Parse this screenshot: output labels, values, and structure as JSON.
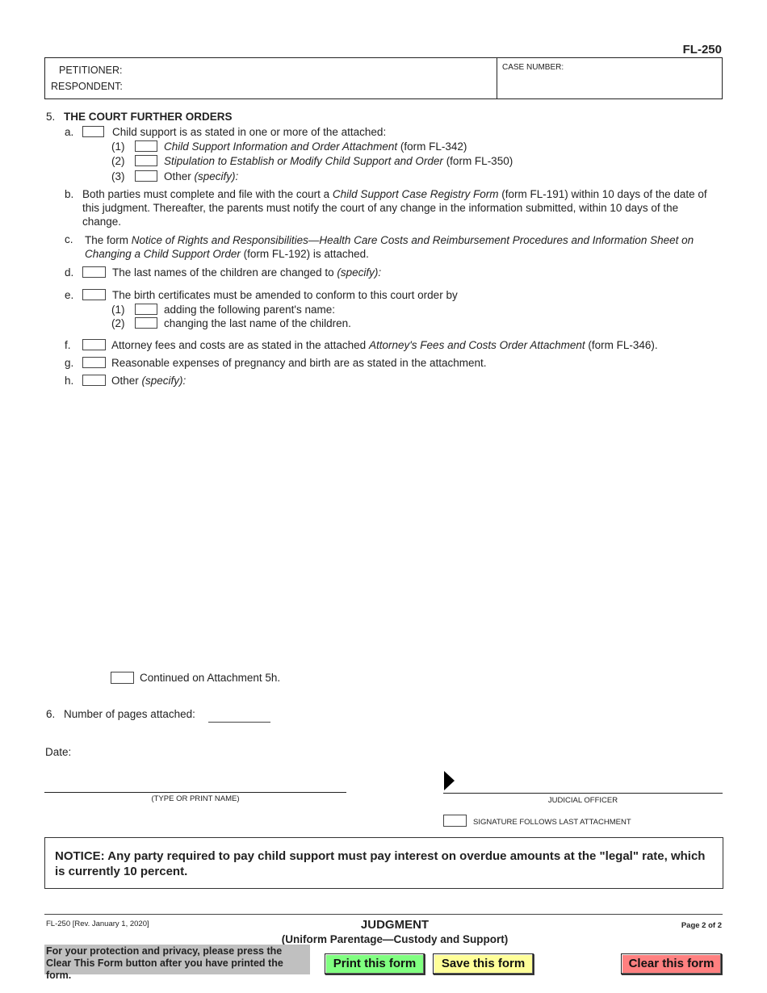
{
  "header": {
    "form_number": "FL-250",
    "petitioner_label": "PETITIONER:",
    "respondent_label": "RESPONDENT:",
    "case_number_label": "CASE NUMBER:"
  },
  "section5": {
    "number": "5.",
    "title": "THE COURT FURTHER ORDERS",
    "a": {
      "label": "a.",
      "text": "Child support is as stated in one or more of the attached:",
      "items": [
        {
          "label": "(1)",
          "italic": "Child Support Information and Order Attachment",
          "text": " (form FL-342)"
        },
        {
          "label": "(2)",
          "italic": "Stipulation to Establish or Modify Child Support and Order",
          "text": " (form FL-350)"
        },
        {
          "label": "(3)",
          "text": "Other ",
          "italic": "(specify):"
        }
      ]
    },
    "b": {
      "label": "b.",
      "text1": "Both parties must complete and file with the court a ",
      "italic": "Child Support Case Registry Form",
      "text2": " (form FL-191) within 10 days of the date of this judgment. Thereafter, the parents must notify the court of any change in the information submitted, within 10 days of the change."
    },
    "c": {
      "label": "c.",
      "text1": "The form ",
      "italic": "Notice of Rights and Responsibilities—Health Care Costs and Reimbursement Procedures and Information Sheet on Changing a Child Support Order",
      "text2": " (form FL-192) is attached."
    },
    "d": {
      "label": "d.",
      "text": "The last names of the children are changed to ",
      "italic": "(specify):"
    },
    "e": {
      "label": "e.",
      "text": "The birth certificates must be amended to conform to this court order by",
      "items": [
        {
          "label": "(1)",
          "text": "adding the following parent's name:"
        },
        {
          "label": "(2)",
          "text": "changing the last name of the children."
        }
      ]
    },
    "f": {
      "label": "f.",
      "text1": "Attorney fees and costs are as stated in the attached ",
      "italic": "Attorney's Fees and Costs Order Attachment",
      "text2": " (form FL-346)."
    },
    "g": {
      "label": "g.",
      "text": "Reasonable expenses of pregnancy and birth are as stated in the attachment."
    },
    "h": {
      "label": "h.",
      "text": "Other ",
      "italic": "(specify):"
    },
    "continued": "Continued on Attachment 5h."
  },
  "section6": {
    "number": "6.",
    "text": "Number of  pages attached:"
  },
  "date_label": "Date:",
  "signature": {
    "name_caption": "(TYPE OR PRINT NAME)",
    "officer_caption": "JUDICIAL OFFICER",
    "follows_label": "SIGNATURE FOLLOWS LAST ATTACHMENT"
  },
  "notice": "NOTICE:  Any party required to pay child support must pay interest on overdue amounts at the \"legal\" rate, which is currently 10 percent.",
  "footer": {
    "revision": "FL-250 [Rev. January 1, 2020]",
    "title": "JUDGMENT",
    "subtitle": "(Uniform Parentage—Custody and Support)",
    "page": "Page 2 of 2",
    "privacy": "For your protection and privacy, please press the Clear This Form button after you have printed the form.",
    "buttons": {
      "print": "Print this form",
      "save": "Save this form",
      "clear": "Clear this form"
    },
    "colors": {
      "print": "#80ff80",
      "save": "#ffff99",
      "clear": "#ff8080",
      "privacy_bg": "#c0c0c0"
    }
  }
}
